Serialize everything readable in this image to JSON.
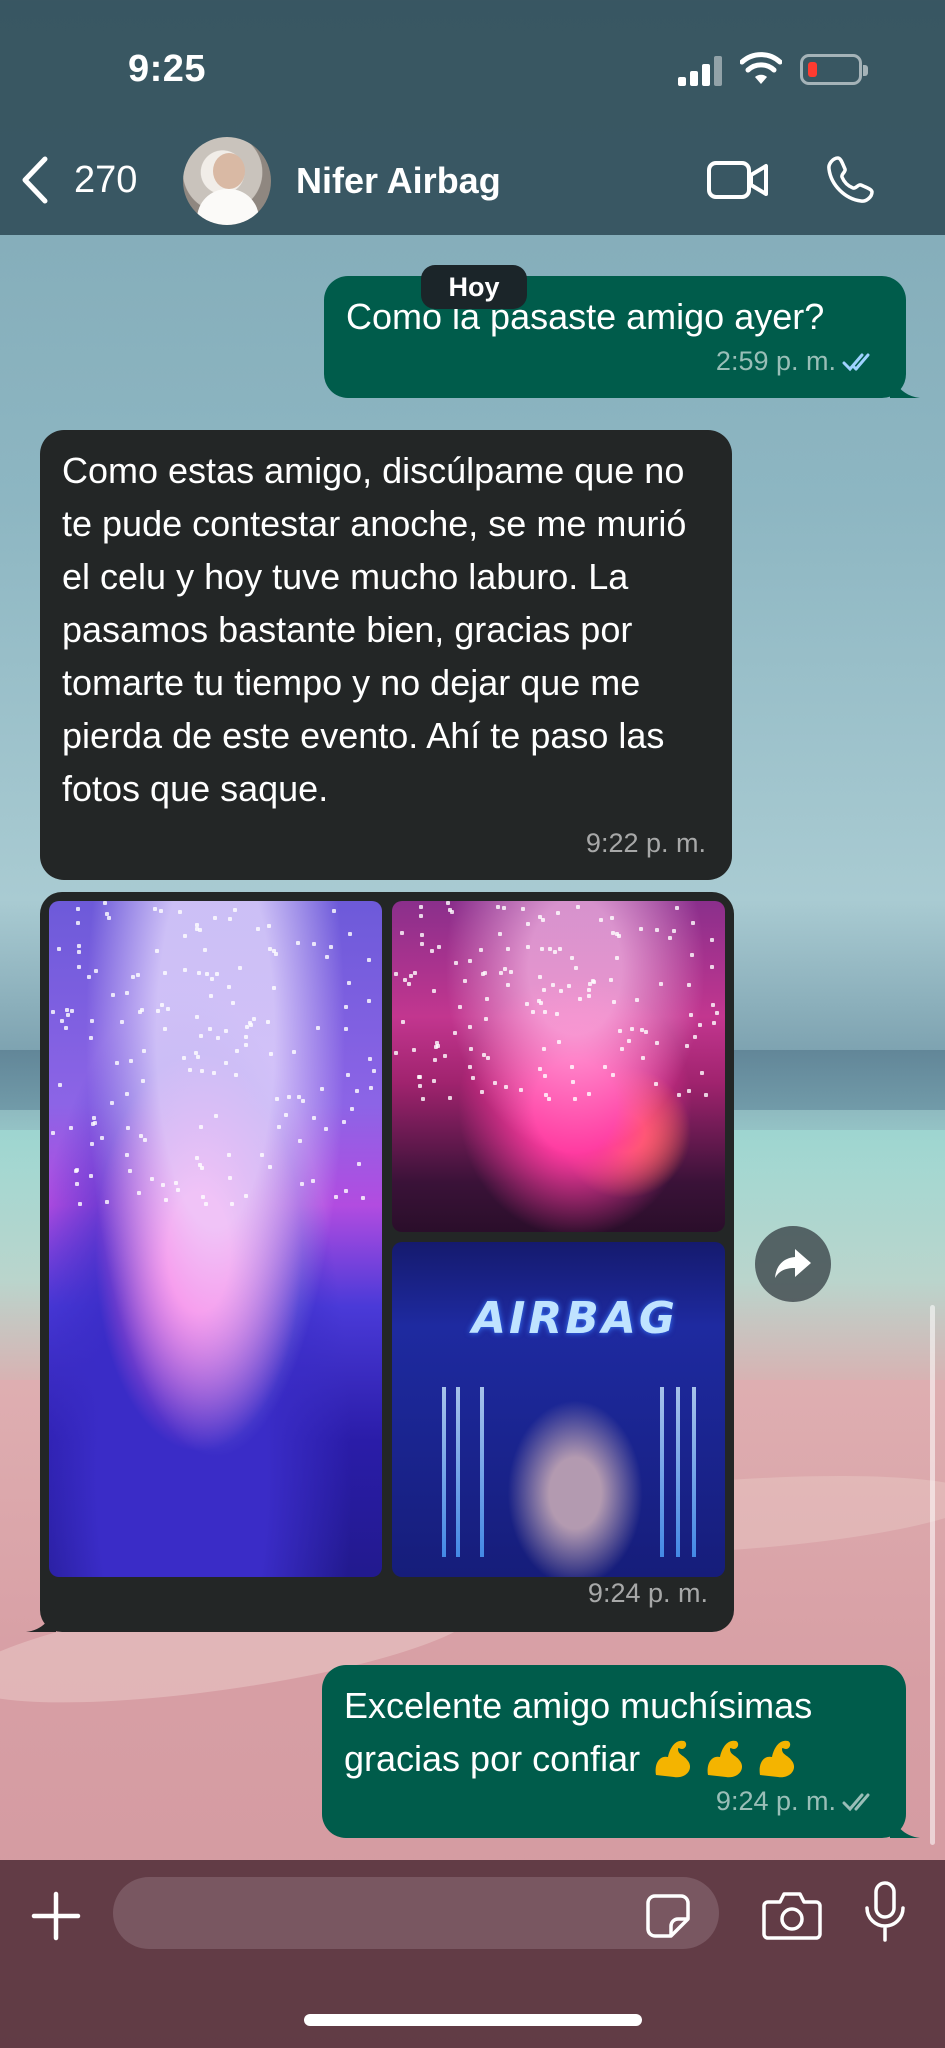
{
  "status_bar": {
    "time": "9:25"
  },
  "header": {
    "back_count": "270",
    "contact_name": "Nifer Airbag",
    "icons": [
      "chevron-left-icon",
      "video-call-icon",
      "phone-icon"
    ]
  },
  "chat": {
    "day_separator": "Hoy",
    "messages": [
      {
        "direction": "out",
        "text": "Como la pasaste amigo ayer?",
        "time": "2:59 p. m.",
        "status": "read"
      },
      {
        "direction": "in",
        "text": "Como estas amigo, discúlpame que no te pude contestar anoche, se me murió el celu y hoy tuve mucho laburo. La pasamos bastante bien, gracias por tomarte tu tiempo y no dejar que me pierda de este evento. Ahí te paso las fotos que saque.",
        "time": "9:22 p. m."
      },
      {
        "direction": "in",
        "type": "photo-album",
        "photo_count": 3,
        "stage_logo_text": "AIRBAG",
        "time": "9:24 p. m."
      },
      {
        "direction": "out",
        "text": "Excelente amigo muchísimas gracias por confiar",
        "emoji": "💪💪💪",
        "time": "9:24 p. m.",
        "status": "delivered"
      }
    ]
  },
  "input_bar": {
    "placeholder": "",
    "icons": [
      "plus-icon",
      "sticker-icon",
      "camera-icon",
      "microphone-icon"
    ]
  },
  "colors": {
    "outgoing_bubble": "#005c4b",
    "incoming_bubble": "#232626",
    "header_bg": "#2f4b56",
    "input_bar_bg": "#58343e",
    "read_ticks": "#9fd3ff"
  }
}
